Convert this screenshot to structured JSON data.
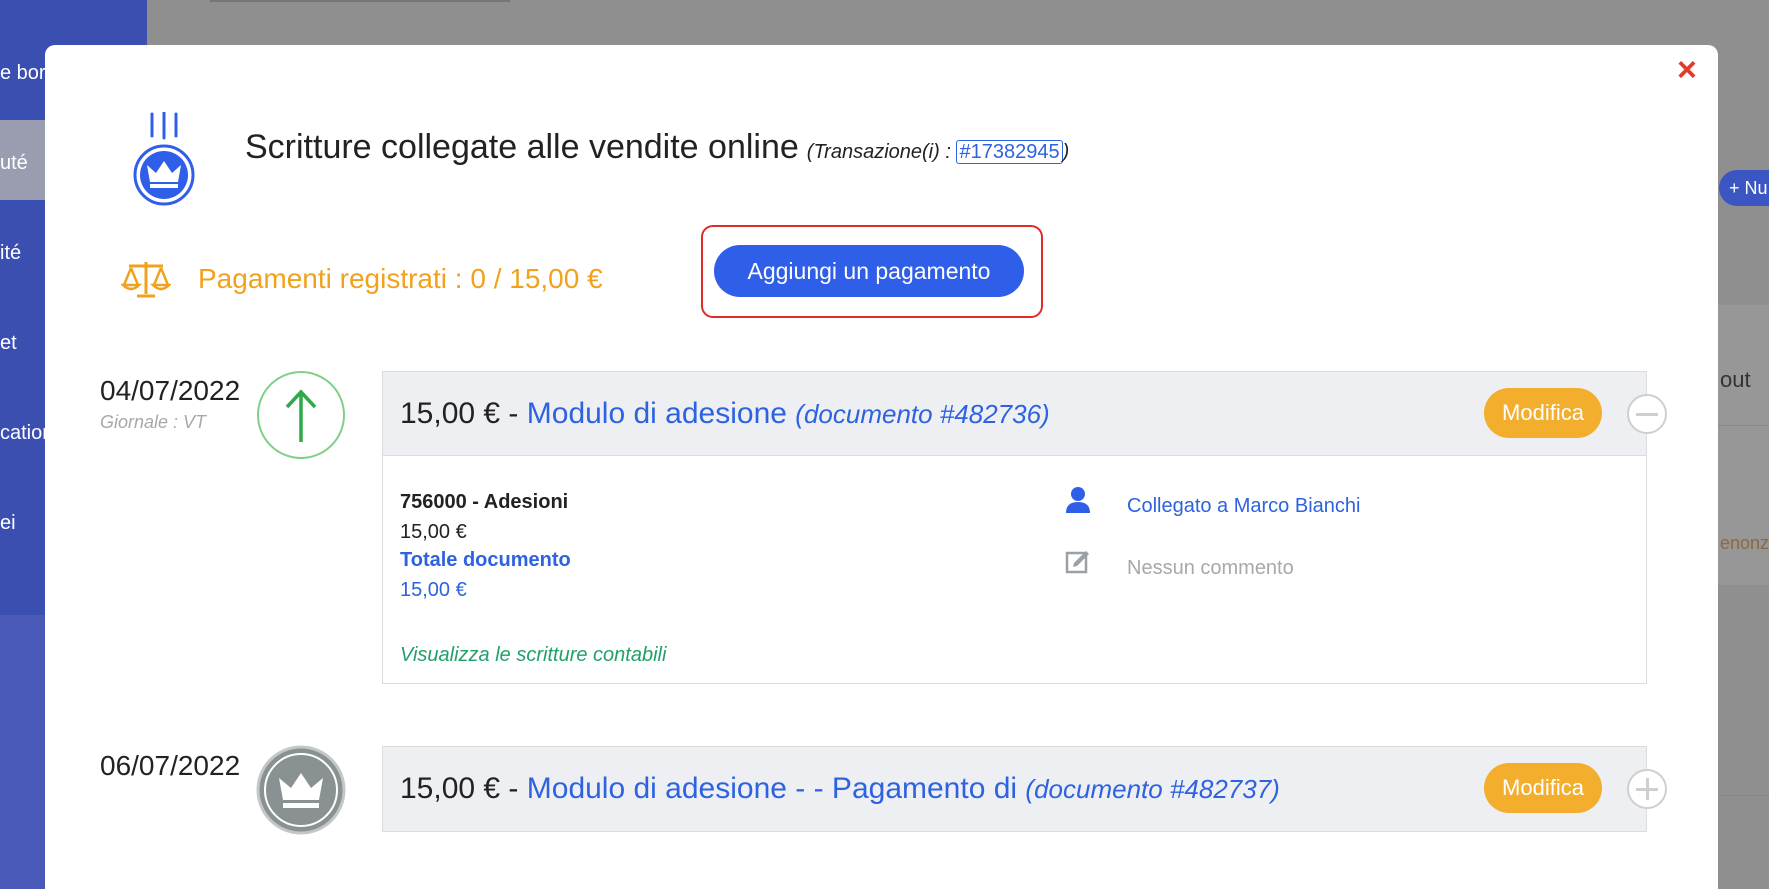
{
  "background": {
    "sidebar_items": [
      "e bor",
      "uté",
      "ité",
      "et",
      "catior",
      "ei"
    ],
    "right_button": "+ Nu",
    "right_text": "out",
    "right_text2": "enonz"
  },
  "modal": {
    "close_label": "×",
    "title": "Scritture collegate alle vendite online",
    "transaction_prefix": "(Transazione(i) :",
    "transaction_id": "#17382945",
    "transaction_suffix": ")",
    "payments_registered": "Pagamenti registrati : 0 / 15,00 €",
    "add_payment_label": "Aggiungi un pagamento"
  },
  "entries": [
    {
      "date": "04/07/2022",
      "journal": "Giornale : VT",
      "amount_prefix": "15,00 € - ",
      "doc_title": "Modulo di adesione",
      "doc_ref": "(documento #482736)",
      "edit_label": "Modifica",
      "account": "756000 - Adesioni",
      "account_amount": "15,00 €",
      "total_label": "Totale documento",
      "total_value": "15,00 €",
      "linked_to": "Collegato a Marco Bianchi",
      "comment": "Nessun commento",
      "view_entries": "Visualizza le scritture contabili"
    },
    {
      "date": "06/07/2022",
      "amount_prefix": "15,00 € - ",
      "doc_title": "Modulo di adesione - - Pagamento di",
      "doc_ref": "(documento #482737)",
      "edit_label": "Modifica"
    }
  ],
  "colors": {
    "accent_blue": "#2f5fe8",
    "warning_orange": "#f1a21d",
    "edit_orange": "#f2ae2c",
    "close_red": "#e33a2c",
    "highlight_red": "#e22b24",
    "incoming_green": "#2eaa4a",
    "gray_circle": "#8a9192"
  }
}
